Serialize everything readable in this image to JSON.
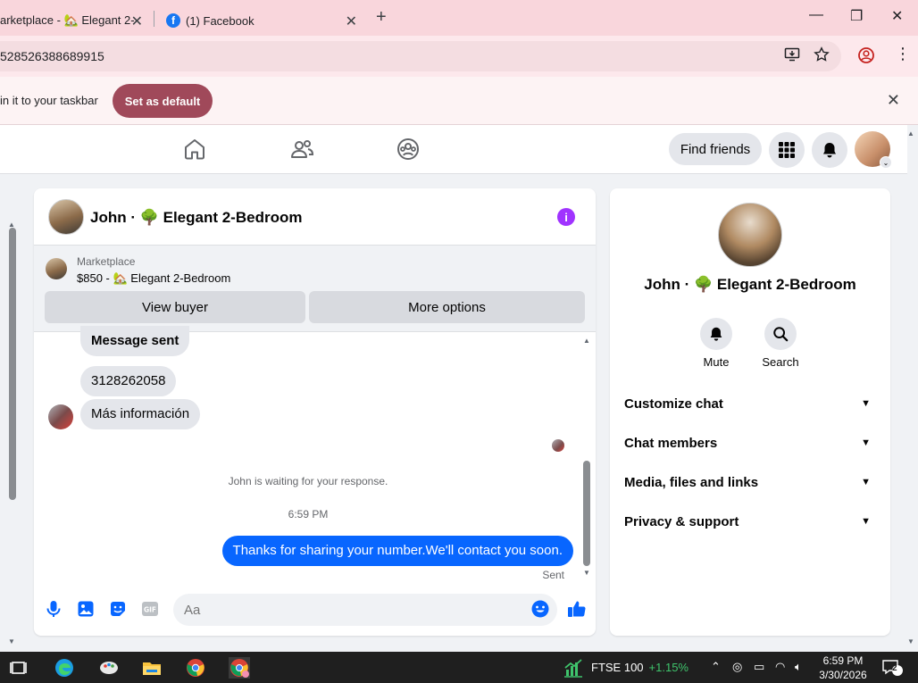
{
  "browser": {
    "tabs": [
      {
        "label": "arketplace - 🏡 Elegant 2-",
        "active": false
      },
      {
        "label": "(1) Facebook",
        "active": true
      }
    ],
    "url": "528526388689915",
    "infobar": {
      "text": "in it to your taskbar",
      "button": "Set as default"
    }
  },
  "fb_header": {
    "find_friends": "Find friends"
  },
  "chat": {
    "title": "John · 🌳 Elegant 2-Bedroom",
    "marketplace_label": "Marketplace",
    "marketplace_listing": "$850 - 🏡 Elegant 2-Bedroom",
    "view_buyer": "View buyer",
    "more_options": "More options",
    "messages": [
      {
        "text": "Message sent",
        "bold": true
      },
      {
        "text": "3128262058"
      },
      {
        "text": "Más información"
      }
    ],
    "waiting_text": "John is waiting for your response.",
    "timestamp": "6:59 PM",
    "outgoing_text": "Thanks for sharing your number.We'll contact you soon.",
    "sent_label": "Sent",
    "input_placeholder": "Aa"
  },
  "side_panel": {
    "name": "John · 🌳 Elegant 2-Bedroom",
    "actions": [
      {
        "label": "Mute",
        "icon": "bell-icon"
      },
      {
        "label": "Search",
        "icon": "search-icon"
      }
    ],
    "sections": [
      {
        "label": "Customize chat"
      },
      {
        "label": "Chat members"
      },
      {
        "label": "Media, files and links"
      },
      {
        "label": "Privacy & support"
      }
    ]
  },
  "taskbar": {
    "ticker_name": "FTSE 100",
    "ticker_change": "+1.15%",
    "time": "6:59 PM",
    "date": "3/30/2026",
    "notification_count": "2"
  },
  "colors": {
    "messenger_blue": "#0866ff",
    "info_purple": "#a033ff",
    "chrome_tab_pink": "#f9d6dc",
    "default_button": "#a0495a"
  }
}
